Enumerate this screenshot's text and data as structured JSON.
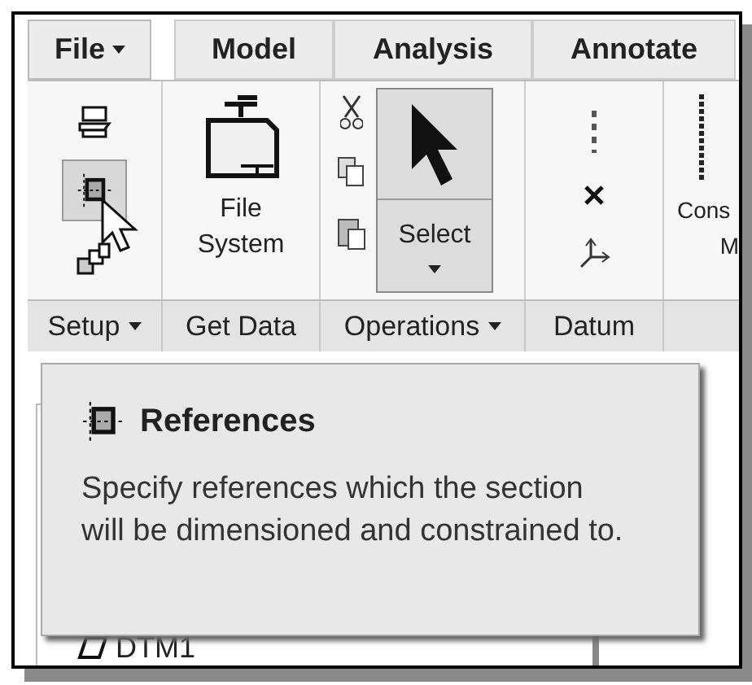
{
  "tabs": [
    {
      "label": "File",
      "kind": "menu"
    },
    {
      "label": "Model",
      "kind": "tab"
    },
    {
      "label": "Analysis",
      "kind": "tab"
    },
    {
      "label": "Annotate",
      "kind": "tab"
    }
  ],
  "setup_tools": [
    {
      "highlighted": false
    },
    {
      "highlighted": true
    },
    {
      "highlighted": false
    }
  ],
  "get_data_button": {
    "label_lines": [
      "File",
      "System"
    ]
  },
  "select_button": {
    "label": "Select",
    "pressed": true
  },
  "cut_off_button": {
    "label_lines": [
      "Cons",
      "M"
    ]
  },
  "group_labels": [
    {
      "label": "Setup",
      "has_menu": true
    },
    {
      "label": "Get Data",
      "has_menu": false
    },
    {
      "label": "Operations",
      "has_menu": true
    },
    {
      "label": "Datum",
      "has_menu": false
    }
  ],
  "tooltip": {
    "title": "References",
    "text": "Specify references which the section will be dimensioned and constrained to."
  },
  "model_tree": {
    "items": [
      {
        "label": "DTM1"
      }
    ]
  }
}
